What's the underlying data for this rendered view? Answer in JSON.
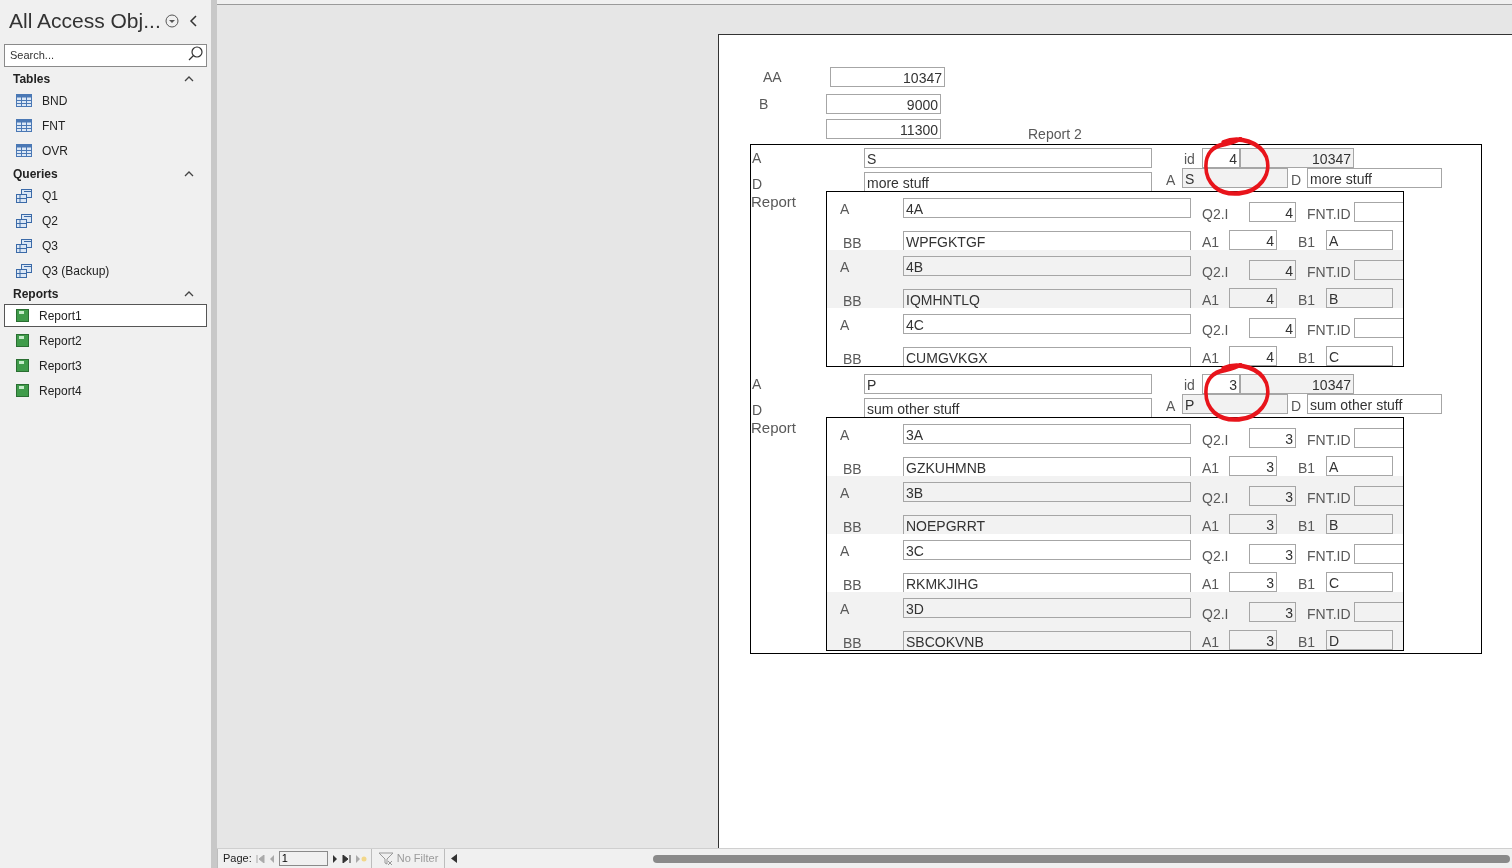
{
  "sidebar": {
    "title": "All Access Obj...",
    "search": {
      "placeholder": "Search..."
    },
    "groups": [
      {
        "label": "Tables",
        "expanded": true,
        "items": [
          {
            "label": "BND",
            "kind": "table",
            "selected": false
          },
          {
            "label": "FNT",
            "kind": "table",
            "selected": false
          },
          {
            "label": "OVR",
            "kind": "table",
            "selected": false
          }
        ]
      },
      {
        "label": "Queries",
        "expanded": true,
        "items": [
          {
            "label": "Q1",
            "kind": "query",
            "selected": false
          },
          {
            "label": "Q2",
            "kind": "query",
            "selected": false
          },
          {
            "label": "Q3",
            "kind": "query",
            "selected": false
          },
          {
            "label": "Q3 (Backup)",
            "kind": "query",
            "selected": false
          }
        ]
      },
      {
        "label": "Reports",
        "expanded": true,
        "items": [
          {
            "label": "Report1",
            "kind": "report",
            "selected": true
          },
          {
            "label": "Report2",
            "kind": "report",
            "selected": false
          },
          {
            "label": "Report3",
            "kind": "report",
            "selected": false
          },
          {
            "label": "Report4",
            "kind": "report",
            "selected": false
          }
        ]
      }
    ]
  },
  "report": {
    "totals": [
      {
        "label": "AA",
        "value": "10347"
      },
      {
        "label": "B",
        "value": "9000"
      },
      {
        "value": "11300"
      }
    ],
    "caption": "Report 2",
    "records": [
      {
        "fields": [
          {
            "label": "A",
            "value": "S"
          },
          {
            "label": "id",
            "value": "4"
          },
          {
            "value": "10347"
          },
          {
            "label": "D",
            "value": "more stuff"
          },
          {
            "label": "A",
            "value": "S"
          },
          {
            "label": "D",
            "value": "more stuff"
          }
        ],
        "subreport_label": "Report",
        "circled": true,
        "rows": [
          {
            "shaded": false,
            "fields": [
              {
                "label": "A",
                "value": "4A"
              },
              {
                "label": "Q2.I",
                "value": "4"
              },
              {
                "label": "FNT.ID"
              },
              {
                "label": "BB",
                "value": "WPFGKTGF"
              },
              {
                "label": "A1",
                "value": "4"
              },
              {
                "label": "B1",
                "value": "A"
              }
            ]
          },
          {
            "shaded": true,
            "fields": [
              {
                "label": "A",
                "value": "4B"
              },
              {
                "label": "Q2.I",
                "value": "4"
              },
              {
                "label": "FNT.ID"
              },
              {
                "label": "BB",
                "value": "IQMHNTLQ"
              },
              {
                "label": "A1",
                "value": "4"
              },
              {
                "label": "B1",
                "value": "B"
              }
            ]
          },
          {
            "shaded": false,
            "fields": [
              {
                "label": "A",
                "value": "4C"
              },
              {
                "label": "Q2.I",
                "value": "4"
              },
              {
                "label": "FNT.ID"
              },
              {
                "label": "BB",
                "value": "CUMGVKGX"
              },
              {
                "label": "A1",
                "value": "4"
              },
              {
                "label": "B1",
                "value": "C"
              }
            ]
          }
        ]
      },
      {
        "fields": [
          {
            "label": "A",
            "value": "P"
          },
          {
            "label": "id",
            "value": "3"
          },
          {
            "value": "10347"
          },
          {
            "label": "D",
            "value": "sum other stuff"
          },
          {
            "label": "A",
            "value": "P"
          },
          {
            "label": "D",
            "value": "sum other stuff"
          }
        ],
        "subreport_label": "Report",
        "circled": true,
        "rows": [
          {
            "shaded": false,
            "fields": [
              {
                "label": "A",
                "value": "3A"
              },
              {
                "label": "Q2.I",
                "value": "3"
              },
              {
                "label": "FNT.ID"
              },
              {
                "label": "BB",
                "value": "GZKUHMNB"
              },
              {
                "label": "A1",
                "value": "3"
              },
              {
                "label": "B1",
                "value": "A"
              }
            ]
          },
          {
            "shaded": true,
            "fields": [
              {
                "label": "A",
                "value": "3B"
              },
              {
                "label": "Q2.I",
                "value": "3"
              },
              {
                "label": "FNT.ID"
              },
              {
                "label": "BB",
                "value": "NOEPGRRT"
              },
              {
                "label": "A1",
                "value": "3"
              },
              {
                "label": "B1",
                "value": "B"
              }
            ]
          },
          {
            "shaded": false,
            "fields": [
              {
                "label": "A",
                "value": "3C"
              },
              {
                "label": "Q2.I",
                "value": "3"
              },
              {
                "label": "FNT.ID"
              },
              {
                "label": "BB",
                "value": "RKMKJIHG"
              },
              {
                "label": "A1",
                "value": "3"
              },
              {
                "label": "B1",
                "value": "C"
              }
            ]
          },
          {
            "shaded": true,
            "fields": [
              {
                "label": "A",
                "value": "3D"
              },
              {
                "label": "Q2.I",
                "value": "3"
              },
              {
                "label": "FNT.ID"
              },
              {
                "label": "BB",
                "value": "SBCOKVNB"
              },
              {
                "label": "A1",
                "value": "3"
              },
              {
                "label": "B1",
                "value": "D"
              }
            ]
          }
        ]
      }
    ]
  },
  "status_bar": {
    "page_label": "Page:",
    "page": "1",
    "filter": {
      "label": "No Filter",
      "active": false
    }
  }
}
